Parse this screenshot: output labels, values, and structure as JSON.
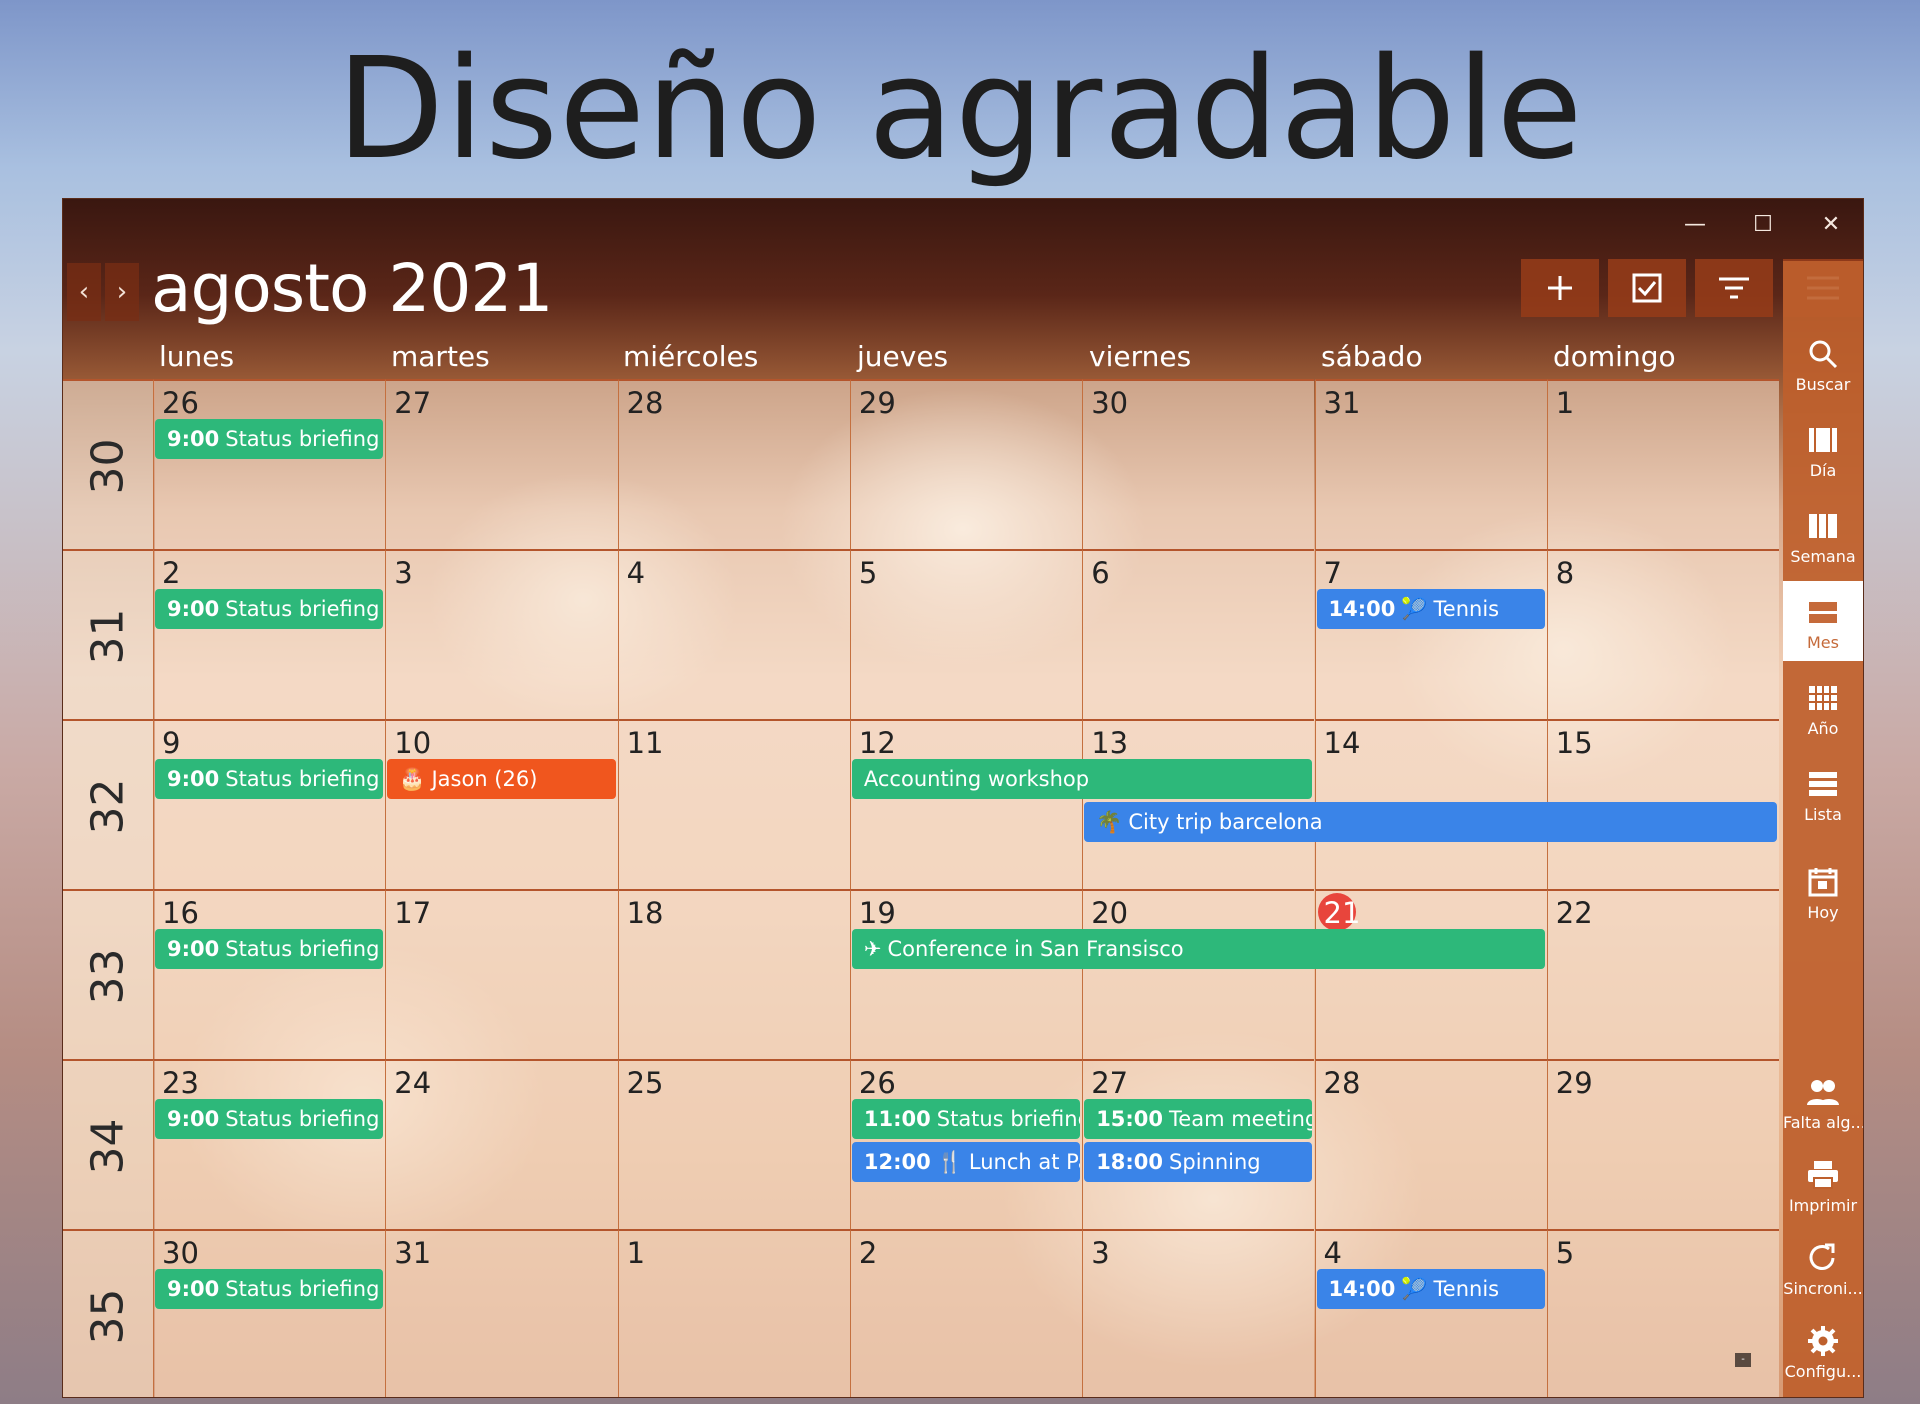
{
  "promo": {
    "title": "Diseño agradable"
  },
  "window": {
    "minimize": "—",
    "maximize": "☐",
    "close": "✕"
  },
  "header": {
    "title": "agosto 2021",
    "prev": "‹",
    "next": "›"
  },
  "toolbar": {
    "add_icon": "plus-icon",
    "task_icon": "checkbox-icon",
    "filter_icon": "filter-icon",
    "menu_icon": "hamburger-icon"
  },
  "weekdays": [
    "lunes",
    "martes",
    "miércoles",
    "jueves",
    "viernes",
    "sábado",
    "domingo"
  ],
  "weeks": [
    {
      "num": "30",
      "days": [
        "26",
        "27",
        "28",
        "29",
        "30",
        "31",
        "1"
      ]
    },
    {
      "num": "31",
      "days": [
        "2",
        "3",
        "4",
        "5",
        "6",
        "7",
        "8"
      ]
    },
    {
      "num": "32",
      "days": [
        "9",
        "10",
        "11",
        "12",
        "13",
        "14",
        "15"
      ]
    },
    {
      "num": "33",
      "days": [
        "16",
        "17",
        "18",
        "19",
        "20",
        "21",
        "22"
      ]
    },
    {
      "num": "34",
      "days": [
        "23",
        "24",
        "25",
        "26",
        "27",
        "28",
        "29"
      ]
    },
    {
      "num": "35",
      "days": [
        "30",
        "31",
        "1",
        "2",
        "3",
        "4",
        "5"
      ]
    }
  ],
  "today": "21",
  "events": [
    {
      "week": 0,
      "day": 0,
      "span": 1,
      "slot": 0,
      "color": "#2db87a",
      "time": "9:00",
      "icon": "",
      "title": "Status briefing"
    },
    {
      "week": 1,
      "day": 0,
      "span": 1,
      "slot": 0,
      "color": "#2db87a",
      "time": "9:00",
      "icon": "",
      "title": "Status briefing"
    },
    {
      "week": 1,
      "day": 5,
      "span": 1,
      "slot": 0,
      "color": "#3a84e8",
      "time": "14:00",
      "icon": "🎾",
      "title": "Tennis"
    },
    {
      "week": 2,
      "day": 0,
      "span": 1,
      "slot": 0,
      "color": "#2db87a",
      "time": "9:00",
      "icon": "",
      "title": "Status briefing"
    },
    {
      "week": 2,
      "day": 1,
      "span": 1,
      "slot": 0,
      "color": "#f0561e",
      "time": "",
      "icon": "🎂",
      "title": "Jason (26)"
    },
    {
      "week": 2,
      "day": 3,
      "span": 2,
      "slot": 0,
      "color": "#2db87a",
      "time": "",
      "icon": "",
      "title": "Accounting workshop"
    },
    {
      "week": 2,
      "day": 4,
      "span": 3,
      "slot": 1,
      "color": "#3a84e8",
      "time": "",
      "icon": "🌴",
      "title": "City trip barcelona"
    },
    {
      "week": 3,
      "day": 0,
      "span": 1,
      "slot": 0,
      "color": "#2db87a",
      "time": "9:00",
      "icon": "",
      "title": "Status briefing"
    },
    {
      "week": 3,
      "day": 3,
      "span": 3,
      "slot": 0,
      "color": "#2db87a",
      "time": "",
      "icon": "✈",
      "title": "Conference in San Fransisco"
    },
    {
      "week": 4,
      "day": 0,
      "span": 1,
      "slot": 0,
      "color": "#2db87a",
      "time": "9:00",
      "icon": "",
      "title": "Status briefing"
    },
    {
      "week": 4,
      "day": 3,
      "span": 1,
      "slot": 0,
      "color": "#2db87a",
      "time": "11:00",
      "icon": "",
      "title": "Status briefing"
    },
    {
      "week": 4,
      "day": 3,
      "span": 1,
      "slot": 1,
      "color": "#3a84e8",
      "time": "12:00",
      "icon": "🍴",
      "title": "Lunch at Pabl"
    },
    {
      "week": 4,
      "day": 4,
      "span": 1,
      "slot": 0,
      "color": "#2db87a",
      "time": "15:00",
      "icon": "",
      "title": "Team meeting"
    },
    {
      "week": 4,
      "day": 4,
      "span": 1,
      "slot": 1,
      "color": "#3a84e8",
      "time": "18:00",
      "icon": "",
      "title": "Spinning"
    },
    {
      "week": 5,
      "day": 0,
      "span": 1,
      "slot": 0,
      "color": "#2db87a",
      "time": "9:00",
      "icon": "",
      "title": "Status briefing"
    },
    {
      "week": 5,
      "day": 5,
      "span": 1,
      "slot": 0,
      "color": "#3a84e8",
      "time": "14:00",
      "icon": "🎾",
      "title": "Tennis"
    }
  ],
  "sidebar": {
    "items": [
      {
        "label": "Buscar",
        "icon": "search-icon",
        "active": false
      },
      {
        "label": "Día",
        "icon": "day-view-icon",
        "active": false
      },
      {
        "label": "Semana",
        "icon": "week-view-icon",
        "active": false
      },
      {
        "label": "Mes",
        "icon": "month-view-icon",
        "active": true
      },
      {
        "label": "Año",
        "icon": "year-view-icon",
        "active": false
      },
      {
        "label": "Lista",
        "icon": "list-view-icon",
        "active": false
      },
      {
        "label": "Hoy",
        "icon": "today-icon",
        "active": false
      }
    ],
    "bottom_items": [
      {
        "label": "Falta alg...",
        "icon": "people-icon"
      },
      {
        "label": "Imprimir",
        "icon": "printer-icon"
      },
      {
        "label": "Sincroni...",
        "icon": "sync-icon"
      },
      {
        "label": "Configu...",
        "icon": "gear-icon"
      }
    ]
  },
  "corner_mark": "-"
}
